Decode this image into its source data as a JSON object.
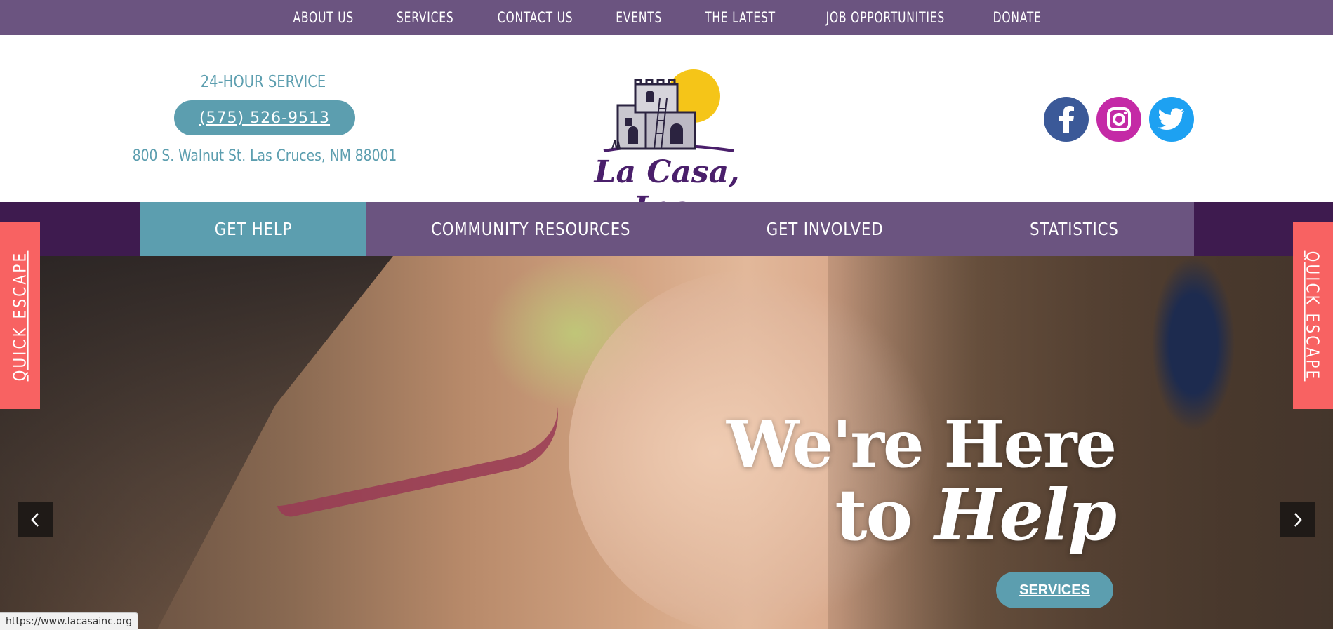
{
  "top_nav": {
    "items": [
      "ABOUT US",
      "SERVICES",
      "CONTACT US",
      "EVENTS",
      "THE LATEST",
      "JOB OPPORTUNITIES",
      "DONATE"
    ]
  },
  "header": {
    "service_label": "24-HOUR SERVICE",
    "phone": "(575) 526-9513",
    "address": "800 S. Walnut St. Las Cruces, NM 88001",
    "logo_text": "La Casa, Inc.",
    "social": [
      {
        "name": "facebook-icon",
        "color": "#3b5998"
      },
      {
        "name": "instagram-icon",
        "color": "#c13584"
      },
      {
        "name": "twitter-icon",
        "color": "#1da1f2"
      }
    ]
  },
  "main_nav": {
    "items": [
      "GET HELP",
      "COMMUNITY RESOURCES",
      "GET INVOLVED",
      "STATISTICS"
    ],
    "active_index": 0
  },
  "hero": {
    "headline_line1": "We're Here",
    "headline_to": "to",
    "headline_emphasis": "Help",
    "button_label": "SERVICES",
    "prev_icon": "chevron-left-icon",
    "next_icon": "chevron-right-icon"
  },
  "quick_escape": {
    "label": "QUICK ESCAPE"
  },
  "status_bar": {
    "url": "https://www.lacasainc.org"
  },
  "colors": {
    "purple": "#6b5480",
    "dark_purple": "#3e1b4f",
    "teal": "#5c9eaf",
    "escape": "#f86262",
    "logo_purple": "#4a1f6b",
    "logo_sun": "#f5c518"
  }
}
